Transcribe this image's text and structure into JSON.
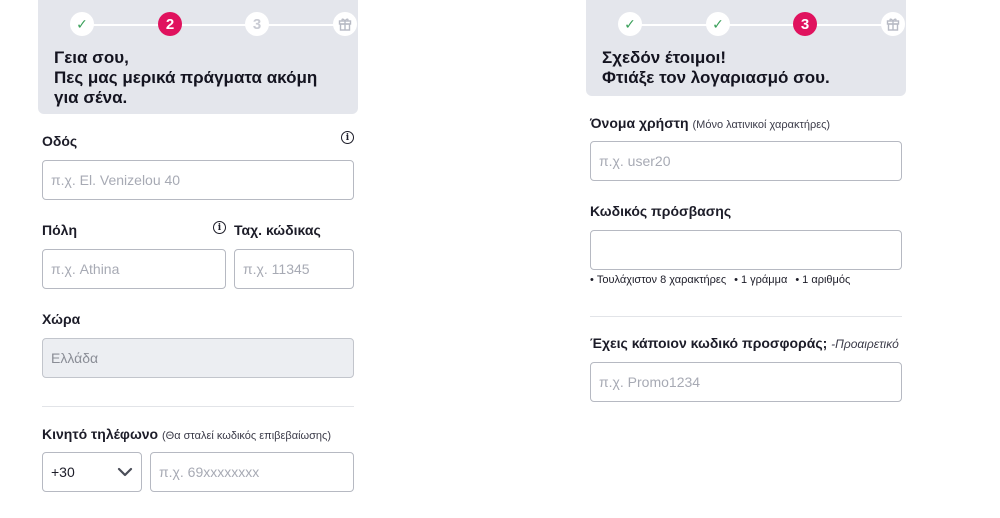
{
  "left": {
    "steps": [
      {
        "state": "done",
        "text": "✓"
      },
      {
        "state": "active",
        "text": "2"
      },
      {
        "state": "todo",
        "text": "3"
      },
      {
        "state": "gift",
        "icon": "gift-icon"
      }
    ],
    "header_line1": "Γεια σου,",
    "header_line2": "Πες μας μερικά πράγματα ακόμη",
    "header_line3": "για σένα.",
    "street": {
      "label": "Οδός",
      "placeholder": "π.χ. El. Venizelou 40"
    },
    "city": {
      "label": "Πόλη",
      "placeholder": "π.χ. Athina"
    },
    "postal": {
      "label": "Ταχ. κώδικας",
      "placeholder": "π.χ. 11345"
    },
    "country": {
      "label": "Χώρα",
      "value": "Ελλάδα"
    },
    "phone": {
      "label": "Κινητό τηλέφωνο",
      "hint": "(Θα σταλεί κωδικός επιβεβαίωσης)",
      "prefix": "+30",
      "placeholder": "π.χ. 69xxxxxxxx"
    }
  },
  "right": {
    "steps": [
      {
        "state": "done",
        "text": "✓"
      },
      {
        "state": "done",
        "text": "✓"
      },
      {
        "state": "active",
        "text": "3"
      },
      {
        "state": "gift",
        "icon": "gift-icon"
      }
    ],
    "header_line1": "Σχεδόν έτοιμοι!",
    "header_line2": "Φτιάξε τον λογαριασμό σου.",
    "username": {
      "label": "Όνομα χρήστη",
      "hint": "(Μόνο λατινικοί χαρακτήρες)",
      "placeholder": "π.χ. user20"
    },
    "password": {
      "label": "Κωδικός πρόσβασης",
      "placeholder": ""
    },
    "requirements": [
      "Τουλάχιστον 8 χαρακτήρες",
      "1 γράμμα",
      "1 αριθμός"
    ],
    "promo": {
      "label": "Έχεις κάποιον κωδικό προσφοράς;",
      "hint": "-Προαιρετικό",
      "placeholder": "π.χ. Promo1234"
    }
  },
  "colors": {
    "accent": "#e0125e",
    "done": "#3aa05a",
    "header_bg": "#e4e6ec"
  }
}
